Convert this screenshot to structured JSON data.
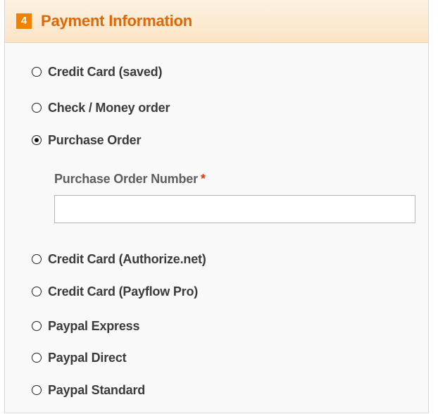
{
  "section": {
    "step_number": "4",
    "title": "Payment Information"
  },
  "payment_methods": [
    {
      "label": "Credit Card (saved)",
      "selected": false
    },
    {
      "label": "Check / Money order",
      "selected": false
    },
    {
      "label": "Purchase Order",
      "selected": true
    },
    {
      "label": "Credit Card (Authorize.net)",
      "selected": false
    },
    {
      "label": "Credit Card (Payflow Pro)",
      "selected": false
    },
    {
      "label": "Paypal Express",
      "selected": false
    },
    {
      "label": "Paypal Direct",
      "selected": false
    },
    {
      "label": "Paypal Standard",
      "selected": false
    }
  ],
  "purchase_order": {
    "label": "Purchase Order Number",
    "required_marker": "*",
    "value": "",
    "placeholder": ""
  },
  "colors": {
    "accent": "#f18200",
    "title": "#e26703",
    "required": "#eb340a"
  }
}
